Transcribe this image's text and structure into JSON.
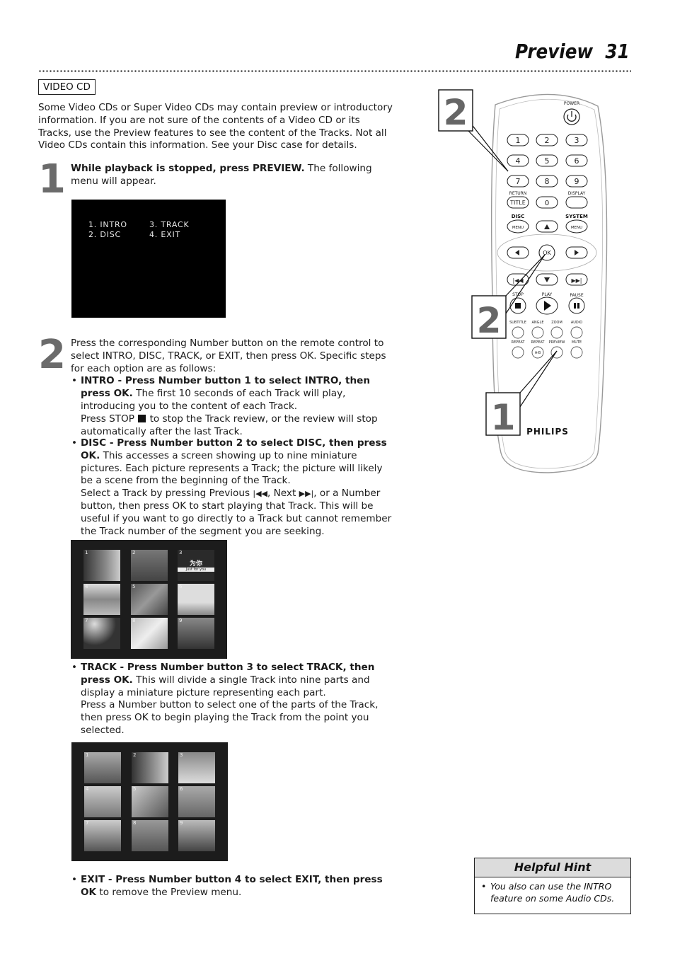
{
  "header": {
    "title": "Preview",
    "page_number": "31"
  },
  "section_tag": "VIDEO CD",
  "intro_paragraph": "Some Video CDs or Super Video CDs may contain preview or introductory information. If you are not sure of the contents of a Video CD or its Tracks, use the Preview features to see the content of the Tracks. Not all Video CDs contain this information. See your Disc case for details.",
  "steps": [
    {
      "number": "1",
      "bold": "While playback is stopped, press PREVIEW.",
      "text": " The following menu will appear."
    },
    {
      "number": "2",
      "text": "Press the corresponding Number button on the remote control to select INTRO, DISC, TRACK, or EXIT, then press OK. Specific steps for each option are as follows:"
    }
  ],
  "preview_menu": {
    "items": [
      "1. INTRO",
      "2. DISC",
      "3. TRACK",
      "4. EXIT"
    ]
  },
  "options": {
    "intro": {
      "bold": "INTRO - Press Number button 1 to select INTRO, then press OK.",
      "text": " The first 10 seconds of each Track will play, introducing you to the content of each Track.",
      "extra_pre": "Press STOP",
      "extra_post": " to stop the Track review, or the review will stop automatically after the last Track."
    },
    "disc": {
      "bold": "DISC - Press Number button 2 to select DISC, then press OK.",
      "text": " This accesses a screen showing up to nine miniature pictures. Each picture represents a Track; the picture will likely be a scene from the beginning of the Track.",
      "extra_a": "Select a Track by pressing Previous ",
      "prev_symbol": "|◀◀",
      "extra_b": ", Next ",
      "next_symbol": "▶▶|",
      "extra_c": ", or a Number button, then press OK to start playing that Track. This will be useful if you want to go directly to a Track but cannot remember the Track number of the segment you are seeking."
    },
    "track": {
      "bold": "TRACK - Press Number button 3 to select TRACK, then press OK.",
      "text": " This will divide a single Track into nine parts and display a miniature picture representing each part.",
      "extra": "Press a Number button to select one of the parts of the Track, then press OK to begin playing the Track from the point you selected."
    },
    "exit": {
      "bold": "EXIT - Press Number button 4 to select EXIT, then press OK",
      "text": " to remove the Preview menu."
    }
  },
  "disc_thumbnails": {
    "labels": [
      "1",
      "2",
      "3",
      "4",
      "5",
      "6",
      "7",
      "8",
      "9"
    ],
    "caption_3_cn": "为你",
    "caption_3_en": "Just for you"
  },
  "track_thumbnails": {
    "labels": [
      "1",
      "2",
      "3",
      "4",
      "5",
      "6",
      "7",
      "8",
      "9"
    ]
  },
  "remote": {
    "brand": "PHILIPS",
    "power_label": "POWER",
    "number_buttons": [
      "1",
      "2",
      "3",
      "4",
      "5",
      "6",
      "7",
      "8",
      "9"
    ],
    "return_label": "RETURN",
    "title_button": "TITLE",
    "zero_button": "0",
    "display_label": "DISPLAY",
    "disc_label": "DISC",
    "system_label": "SYSTEM",
    "menu_button": "MENU",
    "ok_button": "OK",
    "stop_label": "STOP",
    "play_label": "PLAY",
    "pause_label": "PAUSE",
    "func_labels_row1": [
      "SUBTITLE",
      "ANGLE",
      "ZOOM",
      "AUDIO"
    ],
    "func_labels_row2": [
      "REPEAT",
      "REPEAT",
      "PREVIEW",
      "MUTE"
    ],
    "ab_button": "A-B",
    "callouts": [
      "2",
      "2",
      "1"
    ]
  },
  "helpful_hint": {
    "title": "Helpful Hint",
    "items": [
      "You also can use the INTRO feature on some Audio CDs."
    ]
  }
}
